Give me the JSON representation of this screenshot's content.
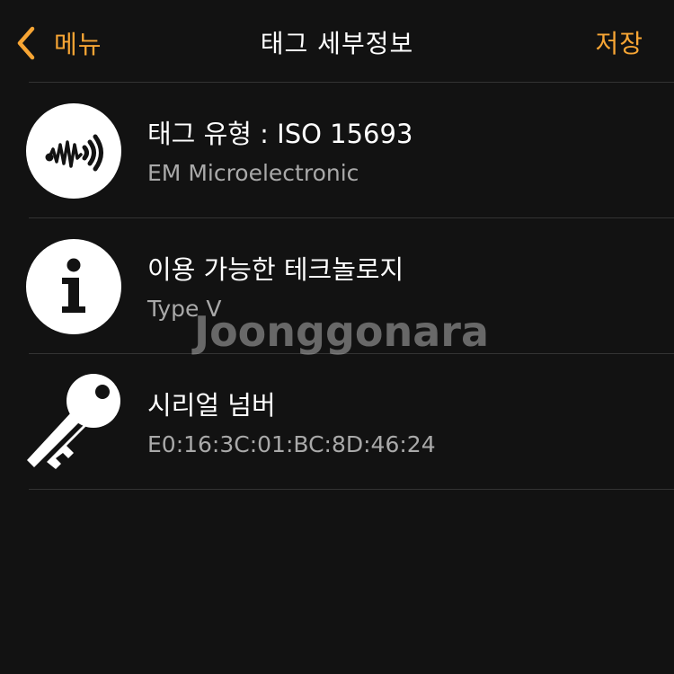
{
  "navbar": {
    "back_label": "메뉴",
    "title": "태그 세부정보",
    "save_label": "저장"
  },
  "rows": [
    {
      "icon": "nfc-wave-icon",
      "title": "태그 유형 : ISO 15693",
      "subtitle": "EM Microelectronic"
    },
    {
      "icon": "info-icon",
      "title": "이용 가능한 테크놀로지",
      "subtitle": "Type V"
    },
    {
      "icon": "key-icon",
      "title": "시리얼 넘버",
      "subtitle": "E0:16:3C:01:BC:8D:46:24"
    }
  ],
  "watermark": "Joonggonara",
  "colors": {
    "background": "#121212",
    "accent": "#f7a534",
    "text_primary": "#ffffff",
    "text_secondary": "#a9a9a9",
    "divider": "#333333"
  }
}
